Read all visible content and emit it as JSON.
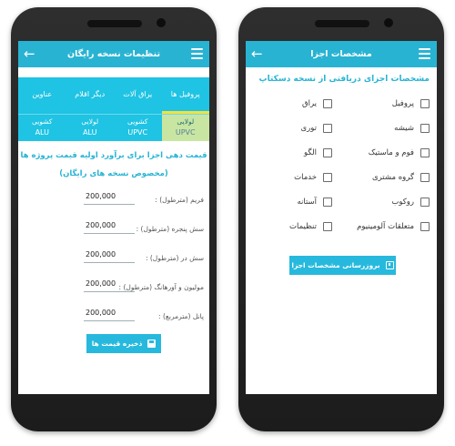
{
  "left_screen": {
    "title": "تنظیمات نسخه رایگان",
    "top_tabs": [
      "پروفیل ها",
      "یراق آلات",
      "دیگر اقلام",
      "عناوین"
    ],
    "sub_tabs": [
      {
        "line1": "لولایی",
        "line2": "UPVC"
      },
      {
        "line1": "کشویی",
        "line2": "UPVC"
      },
      {
        "line1": "لولایی",
        "line2": "ALU"
      },
      {
        "line1": "کشویی",
        "line2": "ALU"
      }
    ],
    "heading_line1": "قیمت دهی اجزا برای برآورد اولیه قیمت پروژه ها",
    "heading_line2": "(مخصوص نسخه های رایگان)",
    "fields": [
      {
        "label": "فریم (مترطول) :",
        "value": "200,000"
      },
      {
        "label": "سش پنجره (مترطول) :",
        "value": "200,000"
      },
      {
        "label": "سش در (مترطول) :",
        "value": "200,000"
      },
      {
        "label": "مولیون و آورهانگ (مترطول) :",
        "value": "200,000"
      },
      {
        "label": "پانل (مترمربع) :",
        "value": "200,000"
      }
    ],
    "save_label": "ذخیره قیمت ها"
  },
  "right_screen": {
    "title": "مشخصات اجزا",
    "subtitle": "مشخصات اجزای دریافتی از نسخه دسکتاپ",
    "checkboxes_right": [
      "پروفیل",
      "شیشه",
      "فوم و ماستیک",
      "گروه مشتری",
      "روکوب",
      "متعلقات آلومینیوم"
    ],
    "checkboxes_left": [
      "یراق",
      "توری",
      "الگو",
      "خدمات",
      "آستانه",
      "تنظیمات"
    ],
    "update_label": "بروزرسانی مشخصات اجزا"
  }
}
